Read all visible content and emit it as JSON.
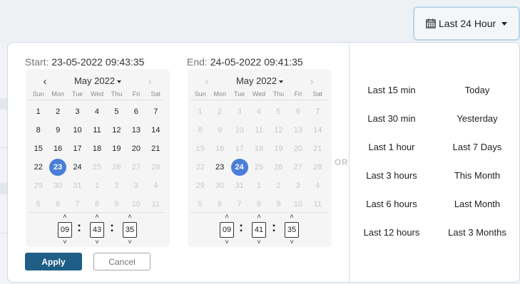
{
  "header": {
    "range_button_label": "Last 24 Hour"
  },
  "start": {
    "label": "Start:",
    "value": "23-05-2022 09:43:35",
    "month_label": "May 2022",
    "time": {
      "hours": "09",
      "minutes": "43",
      "seconds": "35"
    }
  },
  "end": {
    "label": "End:",
    "value": "24-05-2022 09:41:35",
    "month_label": "May 2022",
    "time": {
      "hours": "09",
      "minutes": "41",
      "seconds": "35"
    }
  },
  "weekdays": [
    "Sun",
    "Mon",
    "Tue",
    "Wed",
    "Thu",
    "Fri",
    "Sat"
  ],
  "calendar_days": [
    "1",
    "2",
    "3",
    "4",
    "5",
    "6",
    "7",
    "8",
    "9",
    "10",
    "11",
    "12",
    "13",
    "14",
    "15",
    "16",
    "17",
    "18",
    "19",
    "20",
    "21",
    "22",
    "23",
    "24",
    "25",
    "26",
    "27",
    "28",
    "29",
    "30",
    "31",
    "1",
    "2",
    "3",
    "4",
    "5",
    "6",
    "7",
    "8",
    "9",
    "10",
    "11"
  ],
  "start_enabled_through": "24",
  "start_selected": "23",
  "end_enabled_through": "24",
  "end_selected": "24",
  "separator": "OR",
  "quick_ranges": {
    "left": [
      "Last 15 min",
      "Last 30 min",
      "Last 1 hour",
      "Last 3 hours",
      "Last 6 hours",
      "Last 12 hours"
    ],
    "right": [
      "Today",
      "Yesterday",
      "Last 7 Days",
      "This Month",
      "Last Month",
      "Last 3 Months"
    ]
  },
  "buttons": {
    "apply": "Apply",
    "cancel": "Cancel"
  },
  "icons": {
    "range_button": "calendar-icon",
    "prev": "chevron-left-icon",
    "next": "chevron-right-icon",
    "up": "chevron-up-icon",
    "down": "chevron-down-icon"
  },
  "colors": {
    "accent": "#4a7ed8",
    "apply": "#1f5e86",
    "range_button_border": "#b9d6e8"
  }
}
